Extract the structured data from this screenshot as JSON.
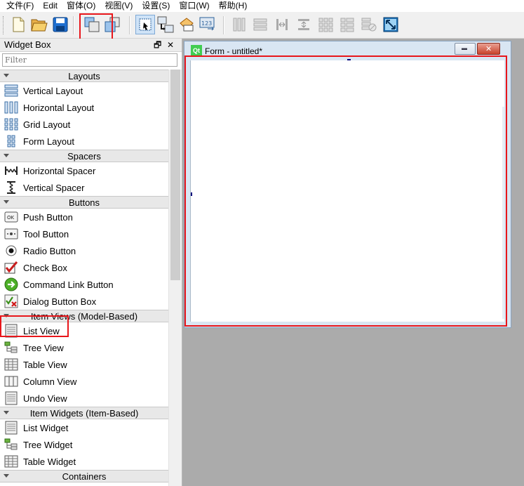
{
  "menubar": {
    "items": [
      {
        "label": "文件(F)"
      },
      {
        "label": "Edit"
      },
      {
        "label": "窗体(O)"
      },
      {
        "label": "视图(V)"
      },
      {
        "label": "设置(S)"
      },
      {
        "label": "窗口(W)"
      },
      {
        "label": "帮助(H)"
      }
    ]
  },
  "toolbar": {
    "buttons": [
      {
        "icon": "new-file-icon"
      },
      {
        "icon": "open-folder-icon"
      },
      {
        "icon": "save-icon"
      },
      {
        "icon": "bring-to-front-icon"
      },
      {
        "icon": "send-to-back-icon"
      },
      {
        "icon": "edit-widgets-icon"
      },
      {
        "icon": "edit-signals-slots-icon"
      },
      {
        "icon": "edit-buddies-icon"
      },
      {
        "icon": "edit-tab-order-icon"
      },
      {
        "icon": "layout-horizontal-icon"
      },
      {
        "icon": "layout-vertical-icon"
      },
      {
        "icon": "layout-horizontal-splitter-icon"
      },
      {
        "icon": "layout-vertical-splitter-icon"
      },
      {
        "icon": "layout-grid-icon"
      },
      {
        "icon": "layout-form-icon"
      },
      {
        "icon": "break-layout-icon"
      },
      {
        "icon": "adjust-size-icon"
      }
    ]
  },
  "widget_box": {
    "title": "Widget Box",
    "filter_placeholder": "Filter",
    "float_glyph": "🗗",
    "close_glyph": "✕",
    "categories": [
      {
        "name": "Layouts",
        "items": [
          "Vertical Layout",
          "Horizontal Layout",
          "Grid Layout",
          "Form Layout"
        ]
      },
      {
        "name": "Spacers",
        "items": [
          "Horizontal Spacer",
          "Vertical Spacer"
        ]
      },
      {
        "name": "Buttons",
        "items": [
          "Push Button",
          "Tool Button",
          "Radio Button",
          "Check Box",
          "Command Link Button",
          "Dialog Button Box"
        ]
      },
      {
        "name": "Item Views (Model-Based)",
        "items": [
          "List View",
          "Tree View",
          "Table View",
          "Column View",
          "Undo View"
        ]
      },
      {
        "name": "Item Widgets (Item-Based)",
        "items": [
          "List Widget",
          "Tree Widget",
          "Table Widget"
        ]
      },
      {
        "name": "Containers",
        "items": []
      }
    ]
  },
  "form_window": {
    "title": "Form - untitled*",
    "logo_text": "Qt",
    "minimize_glyph": "▬",
    "close_glyph": "✕"
  },
  "colors": {
    "highlight": "#e8161b",
    "workspace": "#ababab"
  }
}
